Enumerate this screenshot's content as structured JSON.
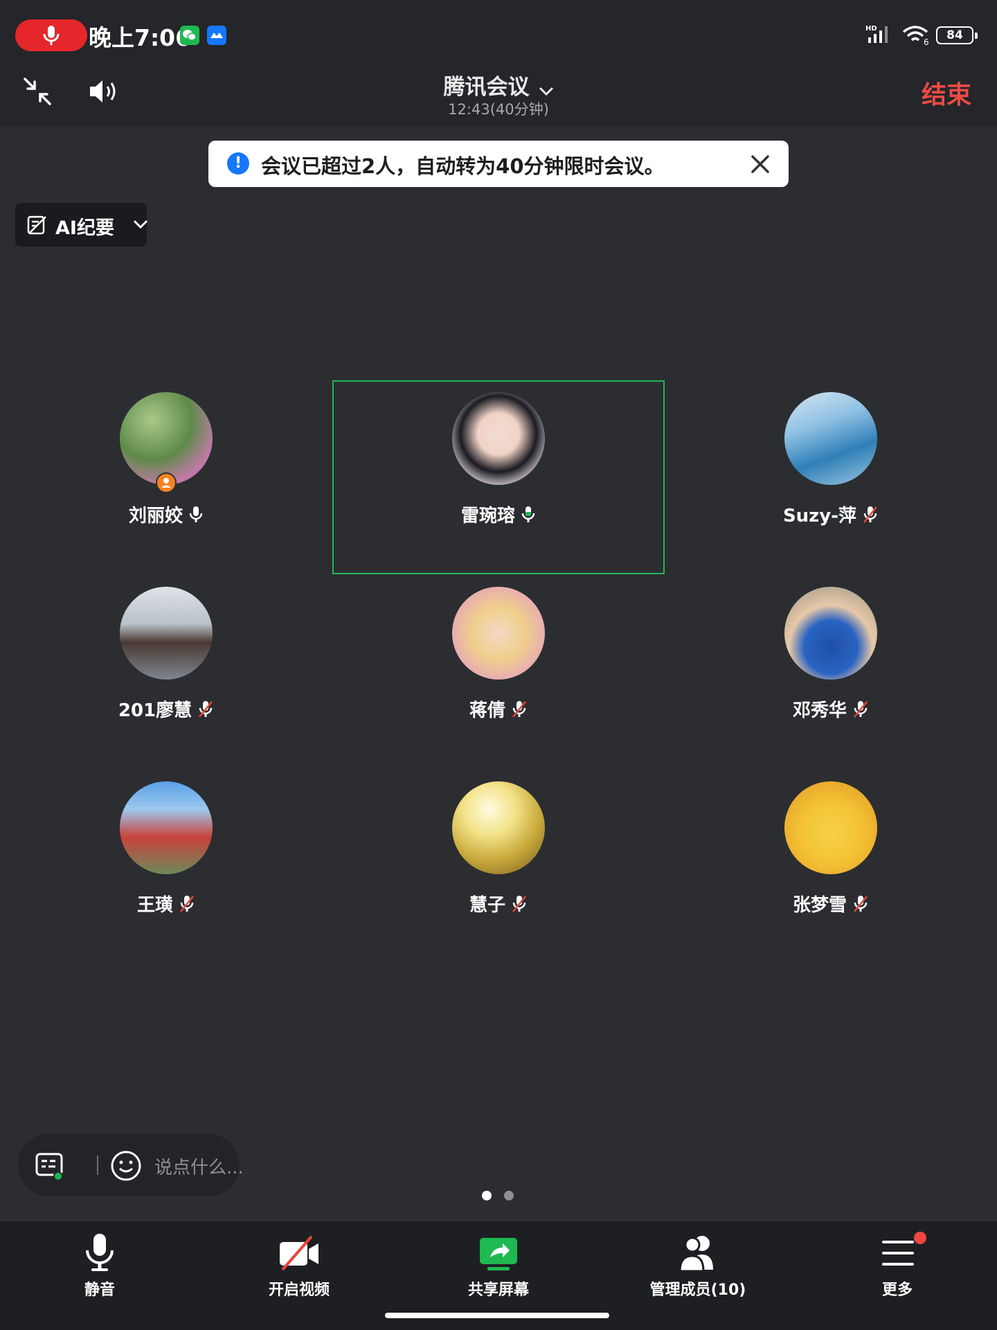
{
  "status_bar": {
    "time": "晚上7:06",
    "network": "HD",
    "wifi_sub": "6",
    "battery": "84"
  },
  "header": {
    "title": "腾讯会议",
    "subtitle": "12:43(40分钟)",
    "end_label": "结束"
  },
  "notice": {
    "text": "会议已超过2人，自动转为40分钟限时会议。"
  },
  "ai_summary": {
    "label": "AI纪要"
  },
  "participants": [
    {
      "name": "刘丽姣",
      "mic": "on",
      "host": true
    },
    {
      "name": "雷琬瑢",
      "mic": "on",
      "speaking": true
    },
    {
      "name": "Suzy-萍",
      "mic": "muted"
    },
    {
      "name": "201廖慧",
      "mic": "muted"
    },
    {
      "name": "蒋倩",
      "mic": "muted"
    },
    {
      "name": "邓秀华",
      "mic": "muted"
    },
    {
      "name": "王璜",
      "mic": "muted"
    },
    {
      "name": "慧子",
      "mic": "muted"
    },
    {
      "name": "张梦雪",
      "mic": "muted"
    }
  ],
  "comment": {
    "placeholder": "说点什么..."
  },
  "pagination": {
    "current": 1,
    "total": 2
  },
  "toolbar": {
    "mute": "静音",
    "video": "开启视频",
    "share": "共享屏幕",
    "members": "管理成员(10)",
    "more": "更多"
  },
  "colors": {
    "background": "#2b2d31",
    "end_red": "#f04a45",
    "active_green": "#22b559",
    "share_green": "#1fb851",
    "notice_blue": "#1677ff"
  }
}
